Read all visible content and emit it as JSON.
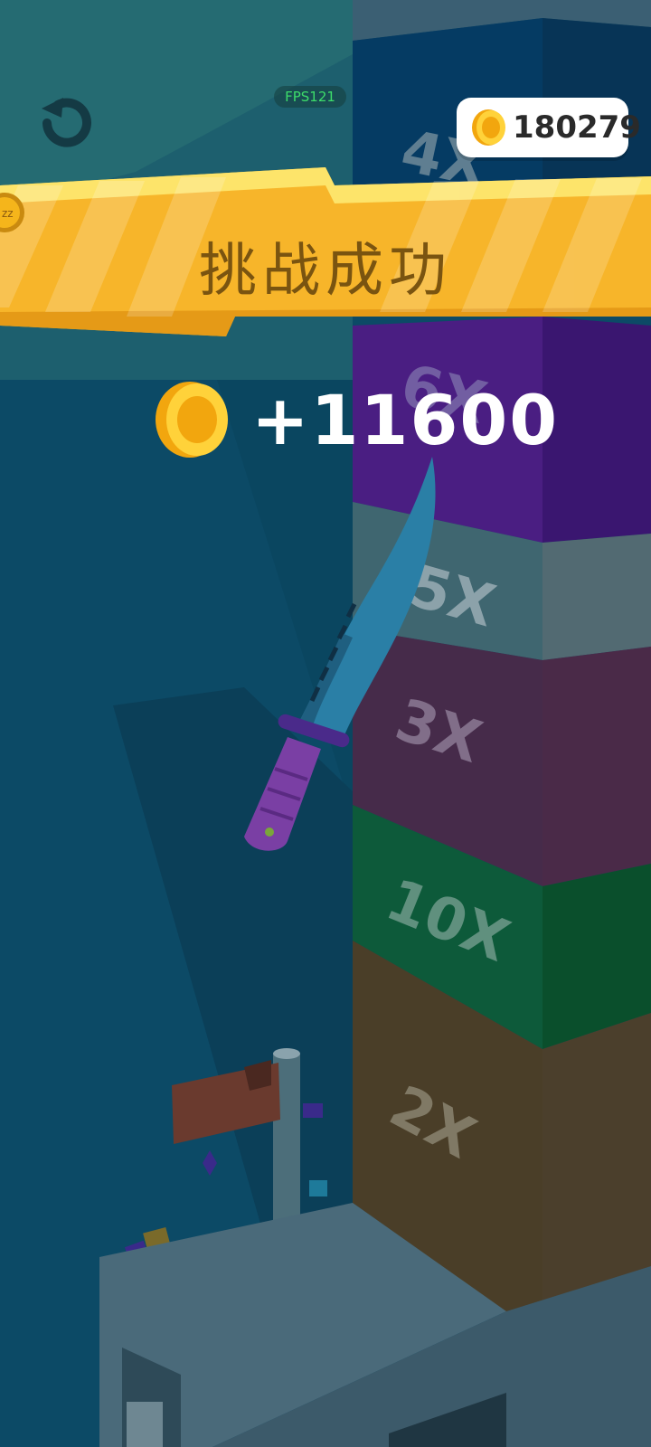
{
  "hud": {
    "fps_label": "FPS121",
    "coin_total": "180279",
    "side_badge": "zz"
  },
  "result": {
    "banner_title": "挑战成功",
    "reward_amount": "+11600"
  },
  "tower": {
    "multipliers": [
      "4X",
      "6X",
      "5X",
      "3X",
      "10X",
      "2X"
    ]
  },
  "colors": {
    "banner_yellow": "#f7b52a",
    "coin_gold": "#f5b51b",
    "knife_blade": "#2a7fa6",
    "knife_handle": "#7a3fa4"
  }
}
